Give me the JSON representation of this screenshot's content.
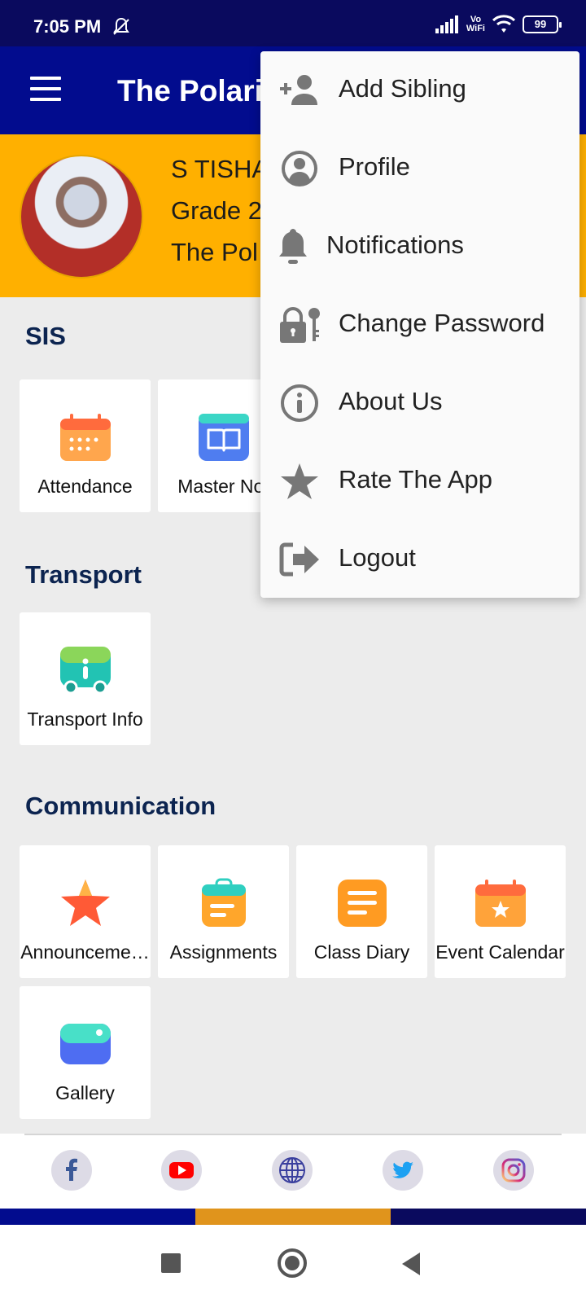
{
  "status_bar": {
    "time": "7:05 PM",
    "network": "Vo\nWiFi",
    "battery": "99"
  },
  "app_bar": {
    "title": "The Polaris"
  },
  "profile": {
    "name": "S TISHA",
    "grade": "Grade 2",
    "school": "The Pol"
  },
  "sections": {
    "sis": {
      "title": "SIS",
      "tiles": [
        "Attendance",
        "Master Not"
      ]
    },
    "transport": {
      "title": "Transport",
      "tiles": [
        "Transport Info"
      ]
    },
    "communication": {
      "title": "Communication",
      "tiles": [
        "Announceme…",
        "Assignments",
        "Class Diary",
        "Event Calendar",
        "Gallery"
      ]
    }
  },
  "social": [
    "facebook-icon",
    "youtube-icon",
    "globe-icon",
    "twitter-icon",
    "instagram-icon"
  ],
  "menu": {
    "items": [
      {
        "label": "Add Sibling",
        "icon": "add-person-icon"
      },
      {
        "label": "Profile",
        "icon": "profile-icon"
      },
      {
        "label": "Notifications",
        "icon": "bell-icon"
      },
      {
        "label": "Change Password",
        "icon": "lock-key-icon"
      },
      {
        "label": "About Us",
        "icon": "info-icon"
      },
      {
        "label": "Rate The App",
        "icon": "star-icon"
      },
      {
        "label": "Logout",
        "icon": "logout-icon"
      }
    ]
  },
  "colors": {
    "app_bar": "#020c8e",
    "banner": "#ffb000",
    "stripe_left": "#020c8e",
    "stripe_mid": "#e0941c",
    "stripe_right": "#0a0a5e"
  }
}
